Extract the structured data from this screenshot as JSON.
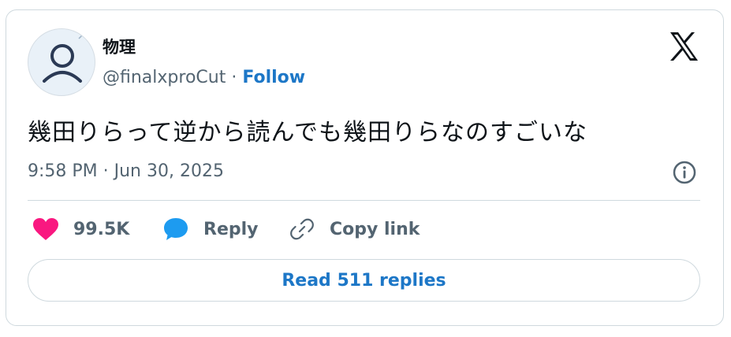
{
  "author": {
    "display_name": "物理",
    "handle": "@finalxproCut",
    "separator": "·",
    "follow_label": "Follow"
  },
  "tweet": {
    "text": "幾田りらって逆から読んでも幾田りらなのすごいな",
    "timestamp": "9:58 PM · Jun 30, 2025"
  },
  "actions": {
    "likes": "99.5K",
    "reply_label": "Reply",
    "copy_link_label": "Copy link"
  },
  "read_replies_label": "Read 511 replies",
  "icons": {
    "logo": "x-logo-icon",
    "info": "info-icon",
    "like": "heart-icon",
    "reply": "chat-bubble-icon",
    "copy": "link-icon"
  },
  "colors": {
    "accent": "#1d77c7",
    "like": "#f91880",
    "reply": "#1d9bf0",
    "muted": "#536471",
    "border": "#cfd9de"
  }
}
